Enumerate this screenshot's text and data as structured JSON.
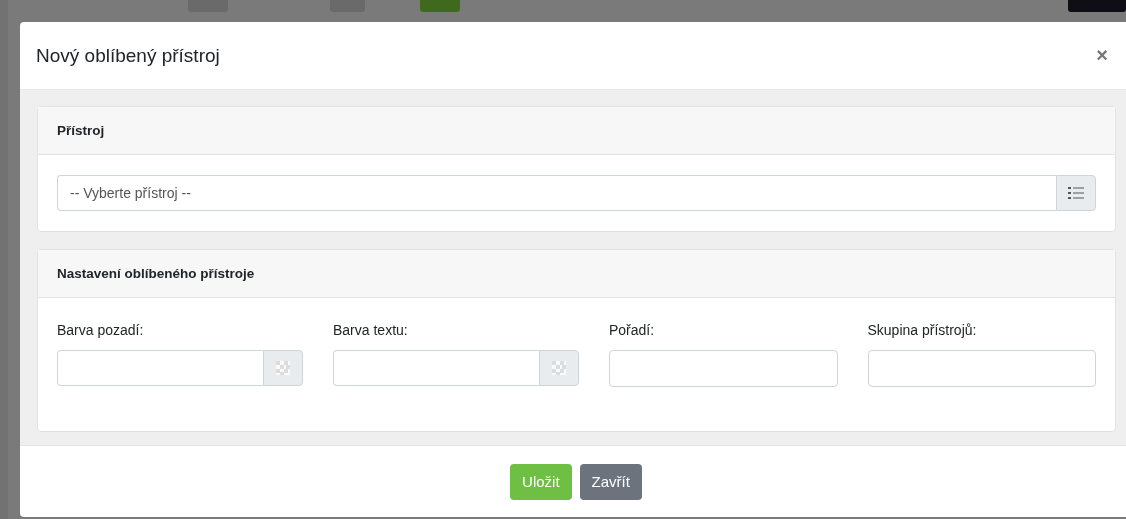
{
  "dialog": {
    "title": "Nový oblíbený přístroj",
    "close": "×"
  },
  "sections": [
    {
      "title": "Přístroj",
      "kind": "select",
      "placeholder": "-- Vyberte přístroj --"
    },
    {
      "title": "Nastavení oblíbeného přístroje",
      "kind": "fields",
      "fields": [
        {
          "label": "Barva pozadí:",
          "kind": "color"
        },
        {
          "label": "Barva textu:",
          "kind": "color"
        },
        {
          "label": "Pořadí:",
          "kind": "text"
        },
        {
          "label": "Skupina přístrojů:",
          "kind": "text"
        }
      ]
    }
  ],
  "buttons": [
    {
      "label": "Uložit",
      "kind": "primary"
    },
    {
      "label": "Zavřít",
      "kind": "secondary"
    }
  ]
}
